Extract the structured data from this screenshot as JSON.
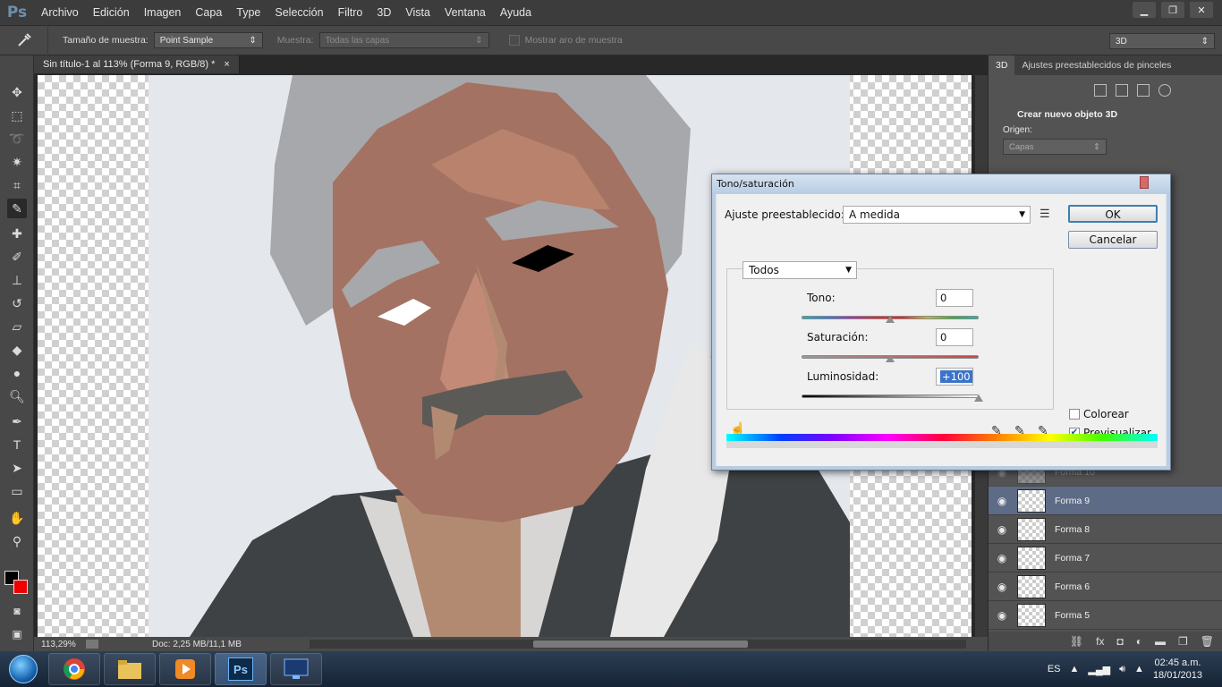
{
  "app": {
    "logo": "Ps"
  },
  "menu": [
    "Archivo",
    "Edición",
    "Imagen",
    "Capa",
    "Type",
    "Selección",
    "Filtro",
    "3D",
    "Vista",
    "Ventana",
    "Ayuda"
  ],
  "window_controls": {
    "minimize": "▁",
    "restore": "❐",
    "close": "✕"
  },
  "options": {
    "sample_label": "Tamaño de muestra:",
    "sample_value": "Point Sample",
    "source_label": "Muestra:",
    "source_value": "Todas las capas",
    "ring_label": "Mostrar aro de muestra",
    "workspace": "3D"
  },
  "document": {
    "tab_title": "Sin título-1 al 113% (Forma 9, RGB/8) *",
    "tab_close": "×",
    "zoom": "113,29%",
    "doc_size": "Doc: 2,25 MB/11,1 MB"
  },
  "panel3d": {
    "tabs": [
      "3D",
      "Ajustes preestablecidos de pinceles"
    ],
    "title": "Crear nuevo objeto 3D",
    "origin_label": "Origen:",
    "origin_value": "Capas"
  },
  "layers": [
    {
      "name": "Forma 10",
      "state": "faded"
    },
    {
      "name": "Forma 9",
      "state": "selected"
    },
    {
      "name": "Forma 8",
      "state": "normal"
    },
    {
      "name": "Forma 7",
      "state": "normal"
    },
    {
      "name": "Forma 6",
      "state": "normal"
    },
    {
      "name": "Forma 5",
      "state": "normal"
    }
  ],
  "dialog": {
    "title": "Tono/saturación",
    "preset_label": "Ajuste preestablecido:",
    "preset_value": "A medida",
    "channel": "Todos",
    "hue_label": "Tono:",
    "hue_value": "0",
    "sat_label": "Saturación:",
    "sat_value": "0",
    "lum_label": "Luminosidad:",
    "lum_value": "+100",
    "ok": "OK",
    "cancel": "Cancelar",
    "colorize_label": "Colorear",
    "colorize_checked": false,
    "preview_label": "Previsualizar",
    "preview_checked": true,
    "hue_level": 0,
    "saturation_level": 0,
    "lightness_level": 100
  },
  "taskbar": {
    "apps": [
      "chrome",
      "explorer",
      "media-player",
      "photoshop",
      "display-settings"
    ],
    "active": "photoshop",
    "photoshop_label": "Ps",
    "language": "ES",
    "time": "02:45 a.m.",
    "date": "18/01/2013"
  }
}
